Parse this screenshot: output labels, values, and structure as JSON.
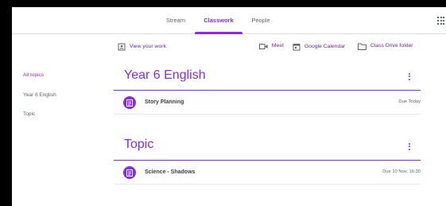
{
  "tabs": [
    {
      "label": "Stream",
      "active": false
    },
    {
      "label": "Classwork",
      "active": true
    },
    {
      "label": "People",
      "active": false
    }
  ],
  "toolbar": {
    "view_work": "View your work",
    "meet": "Meet",
    "calendar": "Google Calendar",
    "drive": "Class Drive folder"
  },
  "sidebar": {
    "items": [
      {
        "label": "All topics",
        "active": true
      },
      {
        "label": "Year 6 English",
        "active": false
      },
      {
        "label": "Topic",
        "active": false
      }
    ]
  },
  "topics": [
    {
      "title": "Year 6 English",
      "assignments": [
        {
          "title": "Story Planning",
          "due": "Due Today"
        }
      ]
    },
    {
      "title": "Topic",
      "assignments": [
        {
          "title": "Science - Shadows",
          "due": "Due 10 Nov, 16:30"
        }
      ]
    }
  ],
  "colors": {
    "accent": "#8a2be2",
    "text": "#3c4043",
    "muted": "#5f6368",
    "frame": "#000000"
  }
}
